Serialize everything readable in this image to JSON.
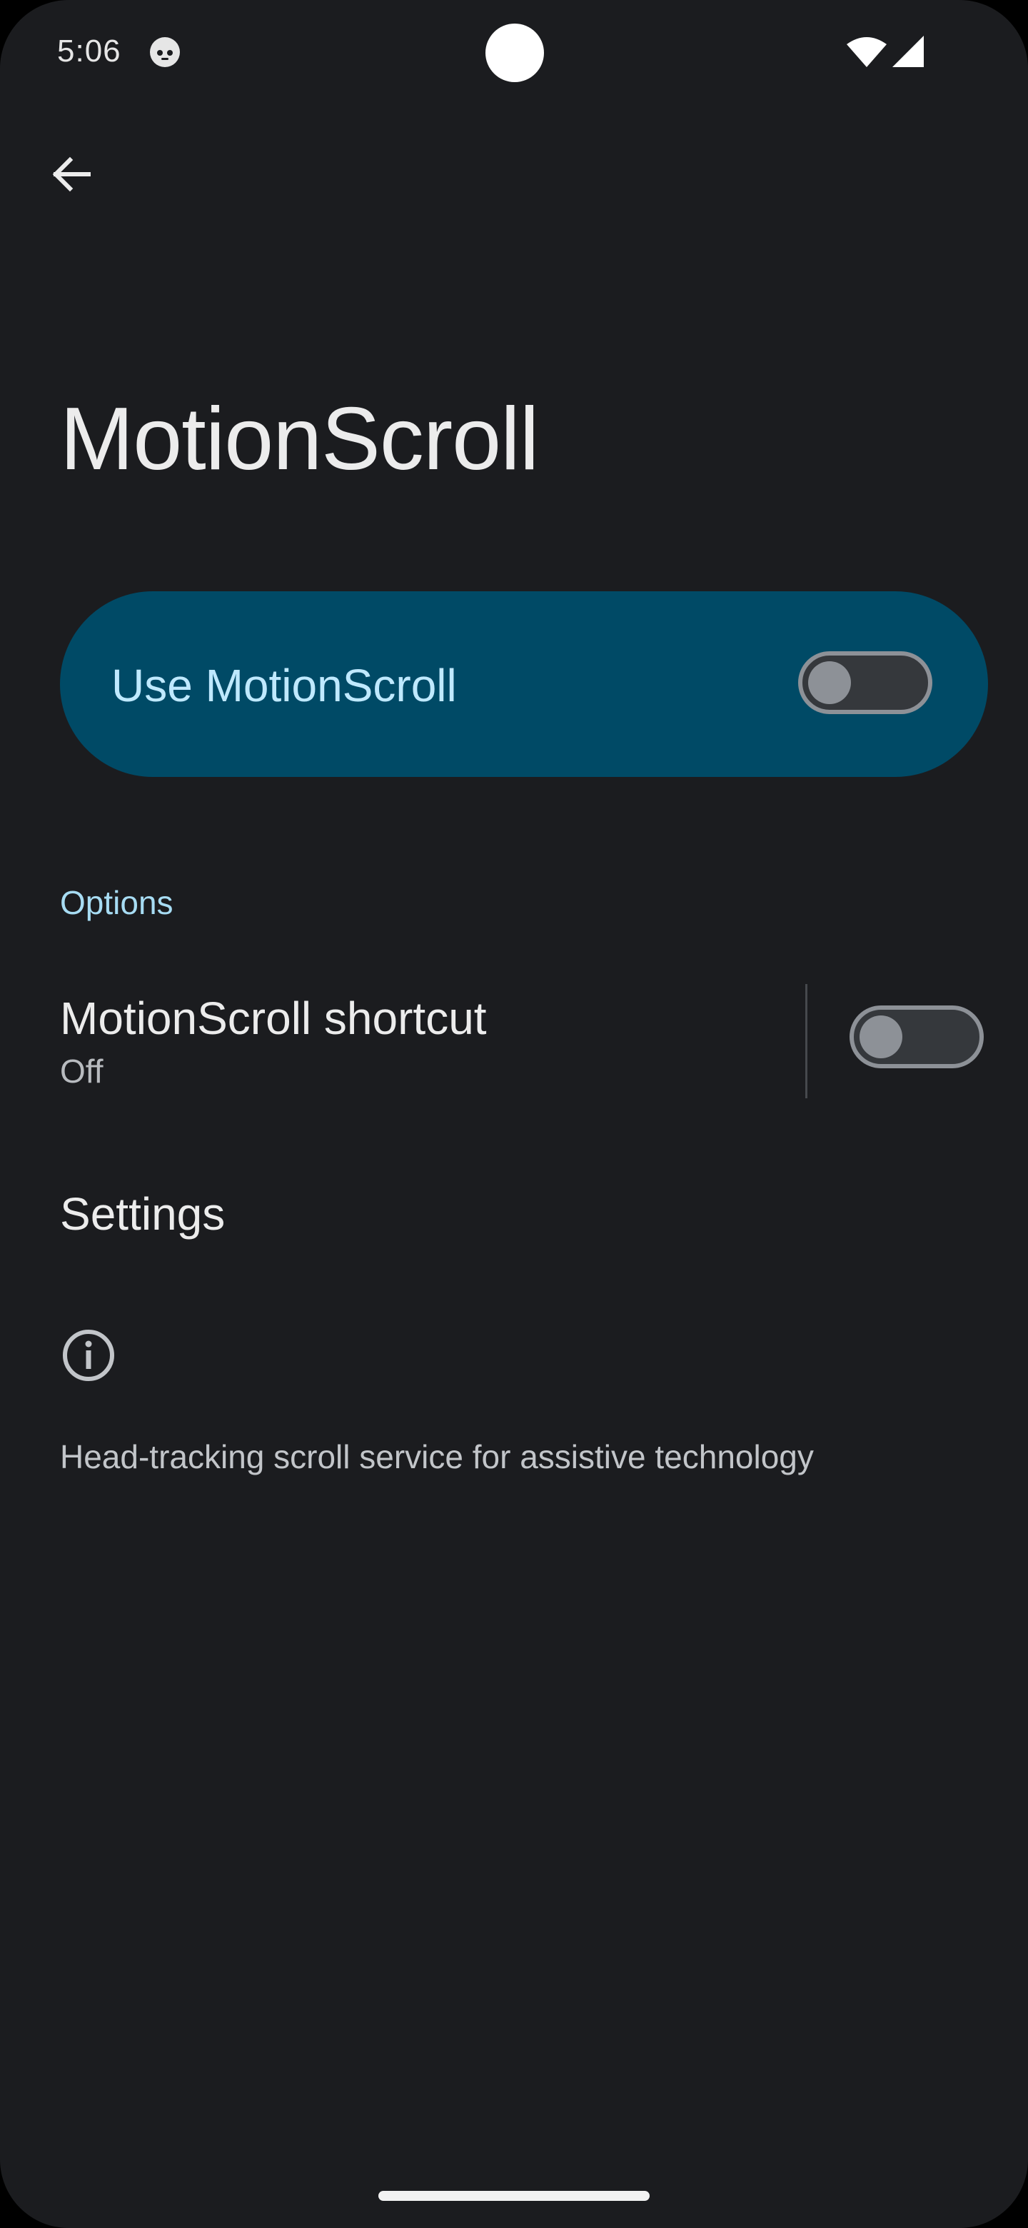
{
  "status_bar": {
    "time": "5:06",
    "icons": [
      "app-notification-icon",
      "wifi-icon",
      "cellular-signal-icon"
    ]
  },
  "header": {
    "back_icon": "arrow-back-icon",
    "title": "MotionScroll"
  },
  "main_switch": {
    "label": "Use MotionScroll",
    "checked": false
  },
  "options": {
    "section_title": "Options",
    "shortcut": {
      "title": "MotionScroll shortcut",
      "summary": "Off",
      "checked": false
    },
    "settings_label": "Settings"
  },
  "footer": {
    "icon": "info-icon",
    "text": "Head-tracking scroll service for assistive technology"
  },
  "colors": {
    "background": "#1b1c1f",
    "banner": "#004a66",
    "banner_text": "#bfe9ff",
    "accent_text": "#a7dcf3",
    "toggle_off": "#8d9197"
  }
}
